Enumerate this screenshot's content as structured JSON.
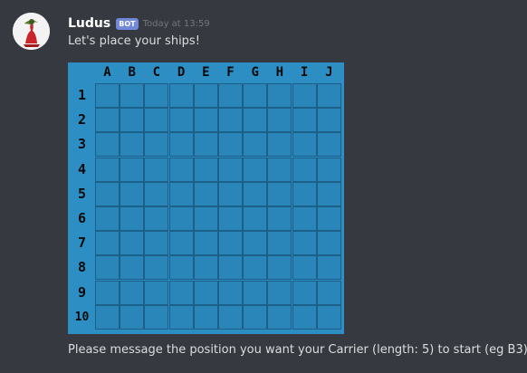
{
  "message": {
    "username": "Ludus",
    "bot_tag": "BOT",
    "timestamp": "Today at 13:59",
    "text": "Let's place your ships!",
    "footer": "Please message the position you want your Carrier (length: 5) to start (eg B3)"
  },
  "board": {
    "columns": [
      "A",
      "B",
      "C",
      "D",
      "E",
      "F",
      "G",
      "H",
      "I",
      "J"
    ],
    "rows": [
      "1",
      "2",
      "3",
      "4",
      "5",
      "6",
      "7",
      "8",
      "9",
      "10"
    ]
  },
  "colors": {
    "background": "#36393f",
    "water": "#2d8ec4",
    "cell": "#2a86b8",
    "grid_line": "#1c5f88",
    "bot_tag": "#7289da"
  }
}
